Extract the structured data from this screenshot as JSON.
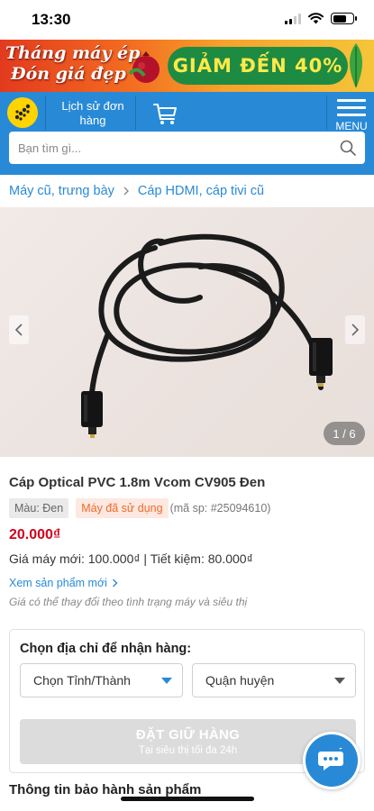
{
  "status_bar": {
    "time": "13:30",
    "battery_level": 0.7
  },
  "promo": {
    "left_line1": "Tháng máy ép",
    "left_line2": "Đón giá đẹp",
    "pill_text": "GIẢM ĐẾN 40%"
  },
  "header": {
    "history_label": "Lịch sử đơn hàng",
    "menu_label": "MENU"
  },
  "search": {
    "placeholder": "Bạn tìm gì..."
  },
  "breadcrumb": {
    "items": [
      "Máy cũ, trưng bày",
      "Cáp HDMI, cáp tivi cũ"
    ]
  },
  "gallery": {
    "counter": "1 / 6"
  },
  "product": {
    "name": "Cáp Optical PVC 1.8m Vcom CV905 Đen",
    "color_tag": "Màu: Đen",
    "status_tag": "Máy đã sử dụng",
    "code": "(mã sp: #25094610)",
    "price": "20.000₫",
    "compare": "Giá máy mới: 100.000₫ | Tiết kiệm: 80.000₫",
    "see_new": "Xem sản phẩm mới",
    "price_note": "Giá có thể thay đổi theo tình trạng máy và siêu thị"
  },
  "delivery": {
    "title": "Chọn địa chỉ để nhận hàng:",
    "province_value": "Chọn Tỉnh/Thành",
    "district_value": "Quận huyện",
    "hold_button": "ĐẶT GIỮ HÀNG",
    "hold_sub": "Tại siêu thị tối đa 24h"
  },
  "warranty": {
    "title": "Thông tin bảo hành sản phẩm"
  },
  "colors": {
    "brand_blue": "#288ad6",
    "price_red": "#d0021b",
    "status_orange": "#f06a2a",
    "logo_yellow": "#ffd400"
  }
}
